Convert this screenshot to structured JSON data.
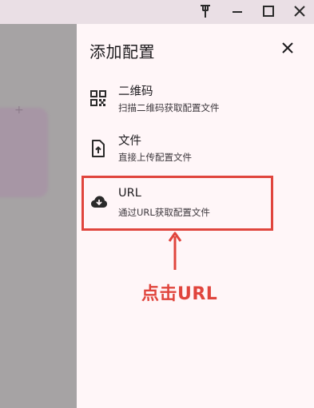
{
  "titlebar": {
    "pin_icon": "pin-icon",
    "minimize_icon": "minimize-icon",
    "maximize_icon": "maximize-icon",
    "close_icon": "close-icon"
  },
  "drawer": {
    "title": "添加配置",
    "close_icon": "close-icon",
    "options": [
      {
        "icon": "qr-code-icon",
        "title": "二维码",
        "subtitle": "扫描二维码获取配置文件"
      },
      {
        "icon": "file-upload-icon",
        "title": "文件",
        "subtitle": "直接上传配置文件"
      },
      {
        "icon": "cloud-download-icon",
        "title": "URL",
        "subtitle": "通过URL获取配置文件"
      }
    ]
  },
  "annotation": {
    "label": "点击URL",
    "color": "#e0453d"
  },
  "colors": {
    "drawer_bg": "#fff6f8",
    "titlebar_bg": "#eadfe5",
    "scrim": "#a6a3a4"
  }
}
